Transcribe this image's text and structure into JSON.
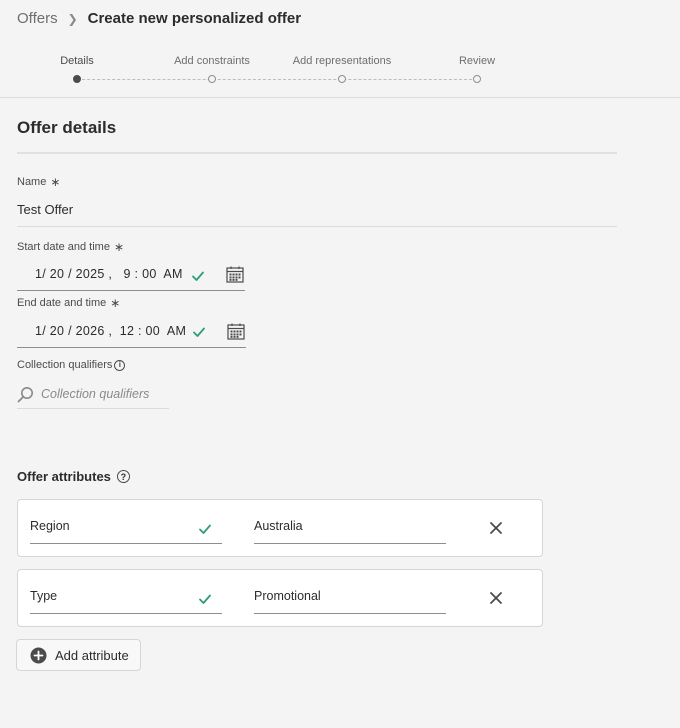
{
  "breadcrumb": {
    "parent": "Offers",
    "current": "Create new personalized offer"
  },
  "stepper": {
    "steps": [
      {
        "label": "Details",
        "active": true
      },
      {
        "label": "Add constraints",
        "active": false
      },
      {
        "label": "Add representations",
        "active": false
      },
      {
        "label": "Review",
        "active": false
      }
    ]
  },
  "offer_details": {
    "title": "Offer details",
    "name": {
      "label": "Name",
      "required_mark": "∗",
      "value": "Test Offer"
    },
    "start": {
      "label": "Start date and time",
      "required_mark": "∗",
      "value": "1/ 20 / 2025 ,   9 : 00  AM"
    },
    "end": {
      "label": "End date and time",
      "required_mark": "∗",
      "value": "1/ 20 / 2026 ,  12 : 00  AM"
    },
    "collection_qualifiers": {
      "label": "Collection qualifiers",
      "info_glyph": "i",
      "placeholder": "Collection qualifiers"
    }
  },
  "offer_attributes": {
    "title": "Offer attributes",
    "help_glyph": "?",
    "items": [
      {
        "key": "Region",
        "value": "Australia"
      },
      {
        "key": "Type",
        "value": "Promotional"
      }
    ],
    "add_label": "Add attribute"
  },
  "colors": {
    "accent_check": "#2d9d78",
    "text_primary": "#2c2c2c",
    "text_muted": "#6e6e6e",
    "background": "#f4f4f4"
  },
  "icons": [
    "chevron-right-icon",
    "check-icon",
    "calendar-icon",
    "info-icon",
    "search-icon",
    "help-icon",
    "close-icon",
    "add-circle-icon"
  ]
}
